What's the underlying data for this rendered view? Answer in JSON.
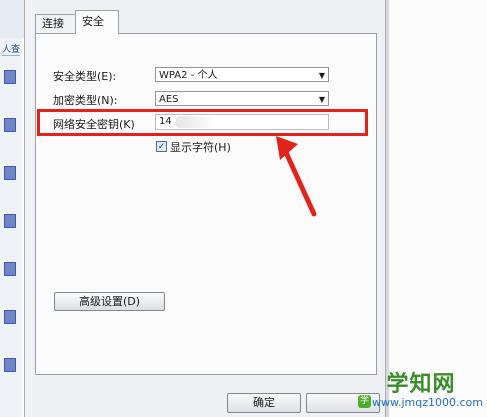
{
  "background": {
    "link_text": "人查"
  },
  "tabs": [
    {
      "label": "连接",
      "active": false
    },
    {
      "label": "安全",
      "active": true
    }
  ],
  "form": {
    "security_type_label": "安全类型(E):",
    "security_type_value": "WPA2 - 个人",
    "encryption_type_label": "加密类型(N):",
    "encryption_type_value": "AES",
    "key_label": "网络安全密钥(K)",
    "key_value": "14",
    "show_chars_label": "显示字符(H)",
    "show_chars_checked": true,
    "advanced_button": "高级设置(D)",
    "ok_button": "确定"
  },
  "watermark": {
    "title": "学知网",
    "url": "www.jmqz1000.com"
  },
  "colors": {
    "highlight": "#e2231a",
    "arrow": "#e2231a"
  }
}
